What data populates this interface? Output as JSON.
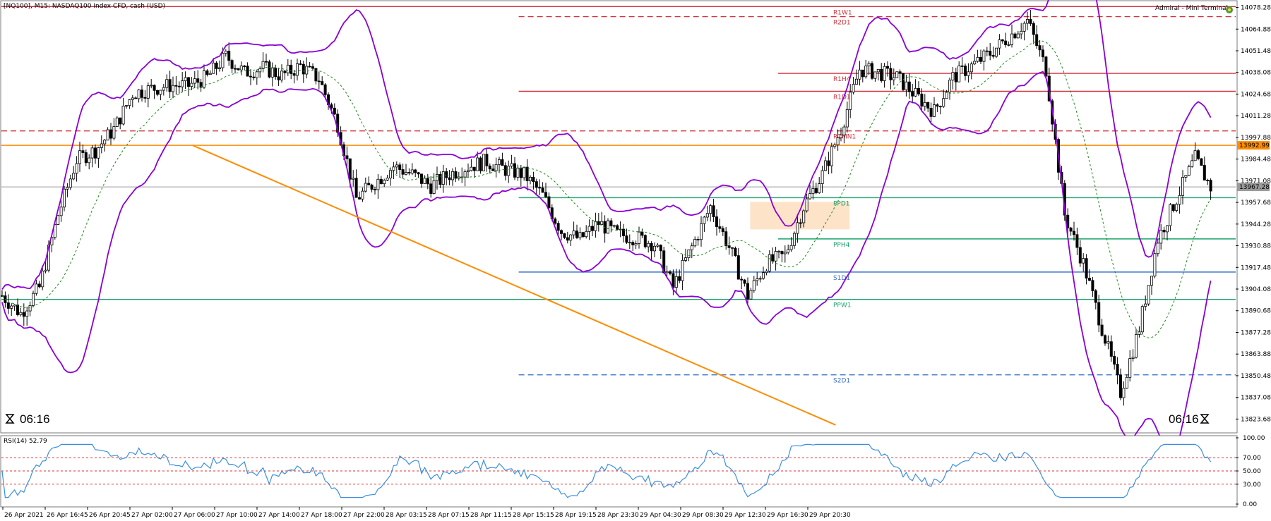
{
  "header": {
    "symbol_label": "[NQ100], M15:  NASDAQ100 Index CFD, cash (USD)",
    "terminal_label": "Admiral - Mini Terminal"
  },
  "timer": {
    "left": "06:16",
    "right": "06:16"
  },
  "rsi_label": "RSI(14) 52.79",
  "colors": {
    "bars": "#000000",
    "bollinger": "#8a00d4",
    "ma": "#1a8a1a",
    "trendline": "#ff8c00",
    "resistance": "#d2323c",
    "pivot": "#1aa36a",
    "support": "#3a73c8",
    "zone": "#fde3c8",
    "rsi_line": "#3b8fe0",
    "rsi_level": "#e03232"
  },
  "chart_data": [
    {
      "type": "candlestick",
      "title": "[NQ100], M15:  NASDAQ100 Index CFD, cash (USD)",
      "y_axis_ticks": [
        "14078.28",
        "14064.88",
        "14051.48",
        "14038.08",
        "14024.68",
        "14011.28",
        "13997.88",
        "13984.48",
        "13971.08",
        "13957.68",
        "13944.28",
        "13930.88",
        "13917.48",
        "13904.08",
        "13890.68",
        "13877.28",
        "13863.88",
        "13850.48",
        "13837.08",
        "13823.68"
      ],
      "ylim": [
        13816,
        14082
      ],
      "x_axis_ticks": [
        "26 Apr 2021",
        "26 Apr 16:45",
        "26 Apr 20:45",
        "27 Apr 02:00",
        "27 Apr 06:00",
        "27 Apr 10:00",
        "27 Apr 14:00",
        "27 Apr 18:00",
        "27 Apr 22:00",
        "28 Apr 03:15",
        "28 Apr 07:15",
        "28 Apr 11:15",
        "28 Apr 15:15",
        "28 Apr 19:15",
        "28 Apr 23:30",
        "29 Apr 04:30",
        "29 Apr 08:30",
        "29 Apr 12:30",
        "29 Apr 16:30",
        "29 Apr 20:30"
      ],
      "current_price_markers": [
        {
          "label": "13992.99",
          "value": 13992.99
        },
        {
          "label": "13967.28",
          "value": 13967.28
        }
      ],
      "close_path": [
        [
          0,
          13900
        ],
        [
          12,
          13889
        ],
        [
          24,
          13905
        ],
        [
          36,
          13950
        ],
        [
          48,
          13984
        ],
        [
          60,
          13990
        ],
        [
          72,
          14003
        ],
        [
          84,
          14025
        ],
        [
          96,
          14028
        ],
        [
          108,
          14030
        ],
        [
          120,
          14030
        ],
        [
          132,
          14035
        ],
        [
          144,
          14048
        ],
        [
          156,
          14038
        ],
        [
          168,
          14041
        ],
        [
          180,
          14036
        ],
        [
          192,
          14042
        ],
        [
          204,
          14034
        ],
        [
          216,
          14006
        ],
        [
          228,
          13960
        ],
        [
          240,
          13970
        ],
        [
          252,
          13980
        ],
        [
          264,
          13975
        ],
        [
          276,
          13968
        ],
        [
          288,
          13975
        ],
        [
          300,
          13980
        ],
        [
          312,
          13983
        ],
        [
          324,
          13978
        ],
        [
          336,
          13975
        ],
        [
          348,
          13962
        ],
        [
          360,
          13940
        ],
        [
          372,
          13935
        ],
        [
          384,
          13945
        ],
        [
          396,
          13938
        ],
        [
          408,
          13936
        ],
        [
          420,
          13932
        ],
        [
          432,
          13905
        ],
        [
          444,
          13930
        ],
        [
          456,
          13955
        ],
        [
          468,
          13930
        ],
        [
          480,
          13900
        ],
        [
          492,
          13920
        ],
        [
          504,
          13925
        ],
        [
          516,
          13955
        ],
        [
          528,
          13975
        ],
        [
          540,
          14003
        ],
        [
          552,
          14040
        ],
        [
          564,
          14038
        ],
        [
          576,
          14035
        ],
        [
          588,
          14024
        ],
        [
          600,
          14014
        ],
        [
          612,
          14035
        ],
        [
          624,
          14042
        ],
        [
          636,
          14050
        ],
        [
          648,
          14060
        ],
        [
          660,
          14070
        ],
        [
          672,
          14040
        ],
        [
          684,
          13950
        ],
        [
          696,
          13920
        ],
        [
          708,
          13880
        ],
        [
          720,
          13840
        ],
        [
          732,
          13880
        ],
        [
          744,
          13935
        ],
        [
          756,
          13960
        ],
        [
          768,
          13985
        ],
        [
          778,
          13967
        ]
      ],
      "levels": [
        {
          "name": "R1W1",
          "value": 14078.8,
          "style": "solid",
          "color": "#d2323c"
        },
        {
          "name": "R2D1",
          "value": 14072.6,
          "style": "dashed",
          "color": "#d2323c"
        },
        {
          "name": "R1H4",
          "value": 14037.5,
          "style": "solid",
          "color": "#d2323c"
        },
        {
          "name": "R1D1",
          "value": 14026.4,
          "style": "solid",
          "color": "#d2323c"
        },
        {
          "name": "R2MN1",
          "value": 14001.9,
          "style": "dashed",
          "color": "#d2323c"
        },
        {
          "name": "PPD1",
          "value": 13960.6,
          "style": "solid",
          "color": "#1aa36a"
        },
        {
          "name": "PPH4",
          "value": 13935.1,
          "style": "solid",
          "color": "#1aa36a"
        },
        {
          "name": "S1D1",
          "value": 13914.6,
          "style": "solid",
          "color": "#3a73c8"
        },
        {
          "name": "PPW1",
          "value": 13897.7,
          "style": "solid",
          "color": "#1aa36a"
        },
        {
          "name": "S2D1",
          "value": 13851.0,
          "style": "dashed",
          "color": "#3a73c8"
        }
      ],
      "bollinger": "upper/lower bands around price",
      "trendline": {
        "from": [
          123,
          13993
        ],
        "to": [
          537,
          13820
        ]
      },
      "zone": {
        "from_bar": 482,
        "to_bar": 546,
        "low": 13941,
        "high": 13958
      }
    },
    {
      "type": "line",
      "title": "RSI(14) 52.79",
      "y_axis_ticks": [
        "100.00",
        "70.00",
        "50.00",
        "30.00",
        "0.00"
      ],
      "ylim": [
        0,
        100
      ],
      "levels": [
        70,
        50,
        30
      ],
      "last_value": 52.79
    }
  ]
}
